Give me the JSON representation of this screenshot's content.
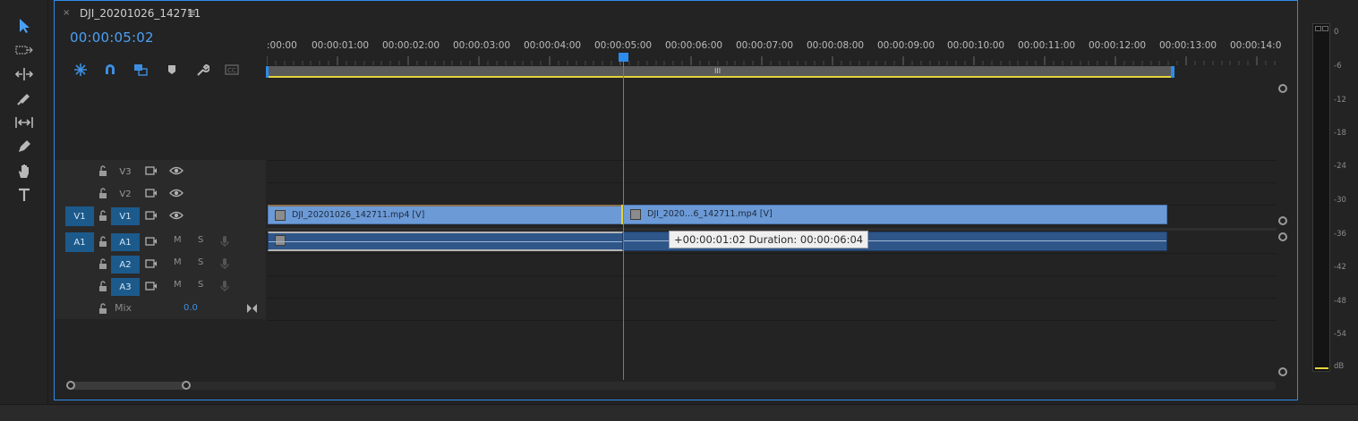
{
  "sequence": {
    "tab_close": "×",
    "tab_title": "DJI_20201026_142711",
    "tab_menu": "≡",
    "current_timecode": "00:00:05:02"
  },
  "ruler": {
    "labels": [
      ":00:00",
      "00:00:01:00",
      "00:00:02:00",
      "00:00:03:00",
      "00:00:04:00",
      "00:00:05:00",
      "00:00:06:00",
      "00:00:07:00",
      "00:00:08:00",
      "00:00:09:00",
      "00:00:10:00",
      "00:00:11:00",
      "00:00:12:00",
      "00:00:13:00",
      "00:00:14:0"
    ],
    "workbar_grip": "III"
  },
  "tracks": {
    "video": [
      {
        "name": "V3",
        "targeted": false
      },
      {
        "name": "V2",
        "targeted": false
      },
      {
        "name": "V1",
        "targeted": true,
        "source": "V1"
      }
    ],
    "audio": [
      {
        "name": "A1",
        "targeted": true,
        "source": "A1",
        "mute": "M",
        "solo": "S"
      },
      {
        "name": "A2",
        "targeted": true,
        "mute": "M",
        "solo": "S"
      },
      {
        "name": "A3",
        "targeted": true,
        "mute": "M",
        "solo": "S"
      }
    ],
    "mix": {
      "label": "Mix",
      "value": "0.0"
    }
  },
  "clips": {
    "v1_left": "DJI_20201026_142711.mp4 [V]",
    "v1_right": "DJI_2020…6_142711.mp4 [V]"
  },
  "tooltip": "+00:00:01:02 Duration: 00:00:06:04",
  "meter": {
    "labels": [
      "0",
      "-6",
      "-12",
      "-18",
      "-24",
      "-30",
      "-36",
      "-42",
      "-48",
      "-54",
      "dB"
    ]
  },
  "colors": {
    "accent": "#2d8ceb",
    "timecode": "#4ba0f5",
    "video_clip": "#6c9ad6",
    "audio_clip": "#2f5689",
    "work_area": "#e6d33a"
  }
}
